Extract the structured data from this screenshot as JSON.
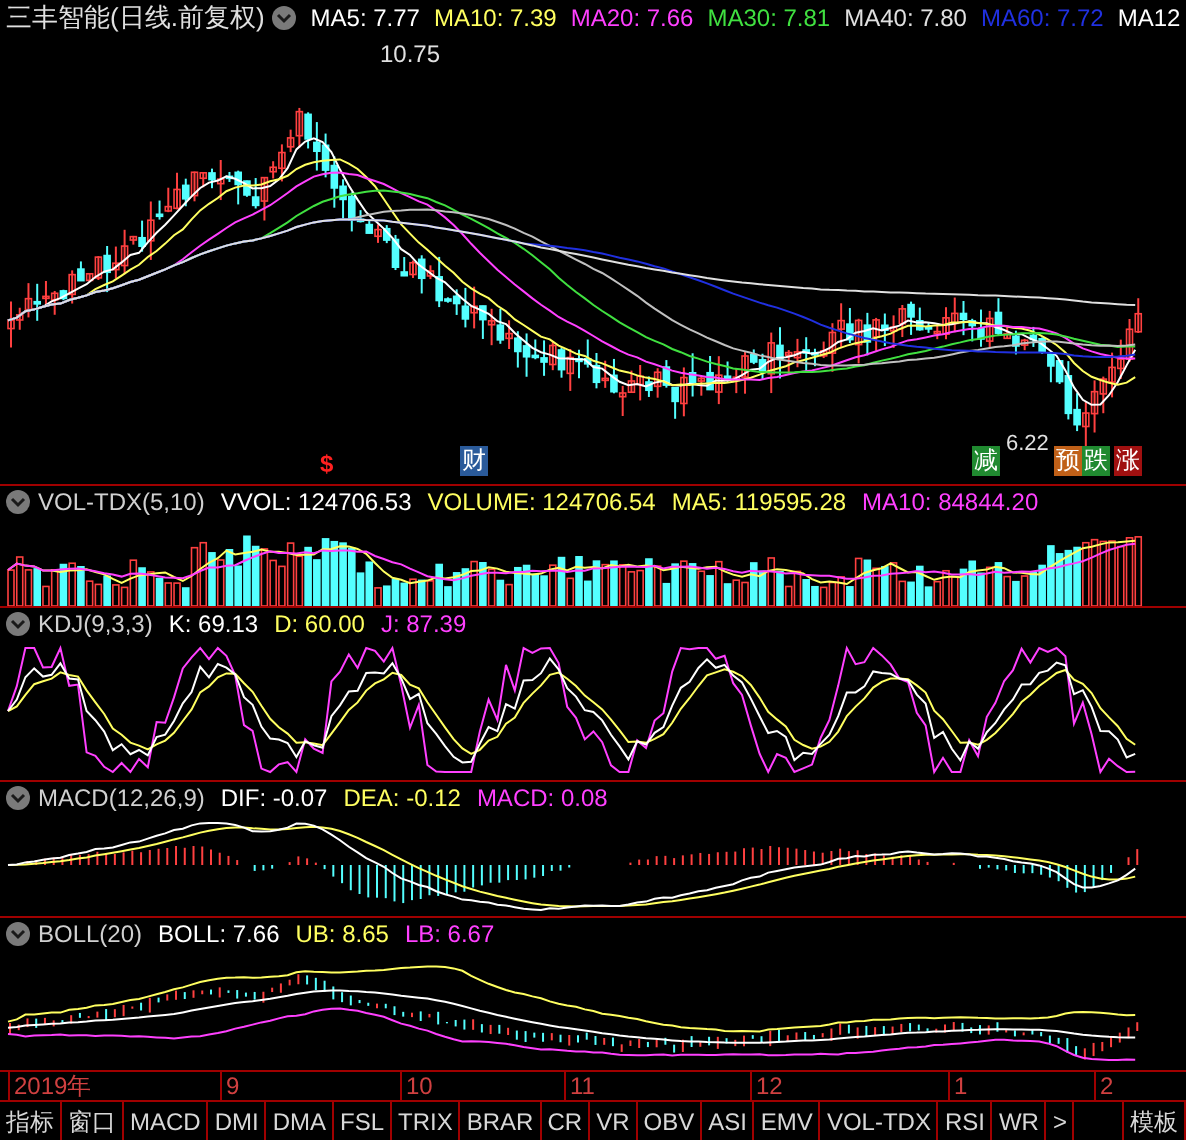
{
  "header": {
    "title": "三丰智能(日线.前复权)",
    "ma_legend": [
      {
        "label": "MA5: 7.77",
        "color": "#ffffff"
      },
      {
        "label": "MA10: 7.39",
        "color": "#ffff60"
      },
      {
        "label": "MA20: 7.66",
        "color": "#ff40ff"
      },
      {
        "label": "MA30: 7.81",
        "color": "#40e040"
      },
      {
        "label": "MA40: 7.80",
        "color": "#e0e0e0"
      },
      {
        "label": "MA60: 7.72",
        "color": "#2030e0"
      },
      {
        "label": "MA12",
        "color": "#ffffff"
      }
    ]
  },
  "main_chart": {
    "high_label": "10.75",
    "low_label": "6.22",
    "markers": [
      {
        "kind": "text",
        "text": "$",
        "color": "#ff2020"
      },
      {
        "kind": "tag",
        "text": "财",
        "color": "#2a5a9a"
      },
      {
        "kind": "tag",
        "text": "减",
        "color": "#208a30"
      },
      {
        "kind": "tag",
        "text": "预",
        "color": "#c06018"
      },
      {
        "kind": "tag",
        "text": "跌",
        "color": "#208a30"
      },
      {
        "kind": "tag",
        "text": "涨",
        "color": "#a01010"
      }
    ]
  },
  "panels": [
    {
      "kind": "volume",
      "title": "VOL-TDX(5,10)",
      "values": [
        {
          "label": "VVOL: 124706.53",
          "color": "#ffffff"
        },
        {
          "label": "VOLUME: 124706.54",
          "color": "#ffff60"
        },
        {
          "label": "MA5: 119595.28",
          "color": "#ffff60"
        },
        {
          "label": "MA10: 84844.20",
          "color": "#ff40ff"
        }
      ]
    },
    {
      "kind": "kdj",
      "title": "KDJ(9,3,3)",
      "values": [
        {
          "label": "K: 69.13",
          "color": "#ffffff"
        },
        {
          "label": "D: 60.00",
          "color": "#ffff60"
        },
        {
          "label": "J: 87.39",
          "color": "#ff40ff"
        }
      ]
    },
    {
      "kind": "macd",
      "title": "MACD(12,26,9)",
      "values": [
        {
          "label": "DIF: -0.07",
          "color": "#ffffff"
        },
        {
          "label": "DEA: -0.12",
          "color": "#ffff60"
        },
        {
          "label": "MACD: 0.08",
          "color": "#ff40ff"
        }
      ]
    },
    {
      "kind": "boll",
      "title": "BOLL(20)",
      "values": [
        {
          "label": "BOLL: 7.66",
          "color": "#ffffff"
        },
        {
          "label": "UB: 8.65",
          "color": "#ffff60"
        },
        {
          "label": "LB: 6.67",
          "color": "#ff40ff"
        }
      ]
    }
  ],
  "date_axis": [
    "2019年",
    "9",
    "10",
    "11",
    "12",
    "1",
    "2"
  ],
  "tabs": [
    "指标",
    "窗口",
    "MACD",
    "DMI",
    "DMA",
    "FSL",
    "TRIX",
    "BRAR",
    "CR",
    "VR",
    "OBV",
    "ASI",
    "EMV",
    "VOL-TDX",
    "RSI",
    "WR",
    ">",
    "模板"
  ]
}
